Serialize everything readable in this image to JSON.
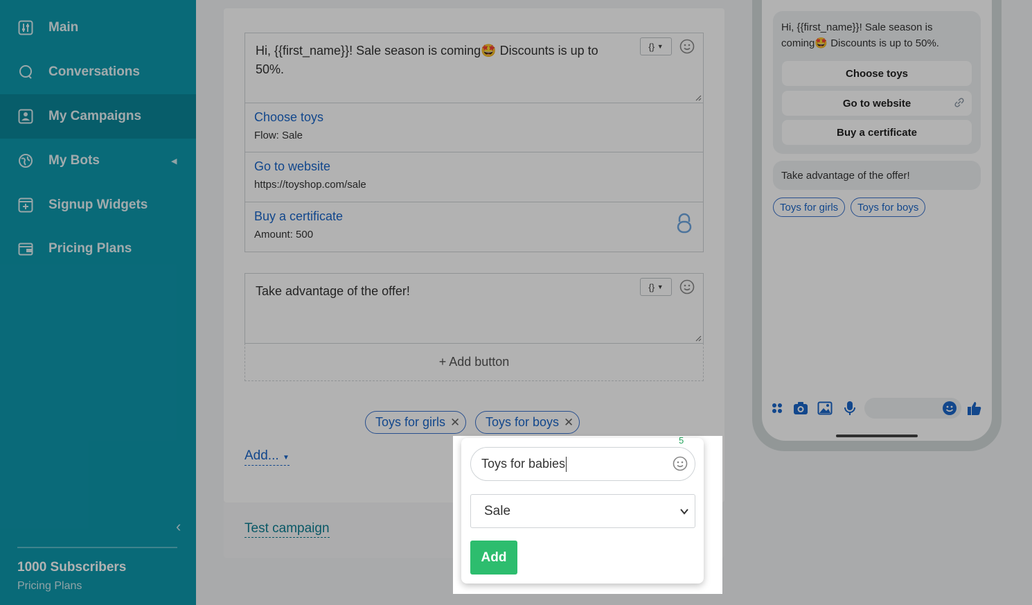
{
  "sidebar": {
    "items": [
      {
        "label": "Main",
        "icon": "sliders-icon"
      },
      {
        "label": "Conversations",
        "icon": "chat-bubble-icon"
      },
      {
        "label": "My Campaigns",
        "icon": "campaign-icon"
      },
      {
        "label": "My Bots",
        "icon": "globe-icon"
      },
      {
        "label": "Signup Widgets",
        "icon": "widget-plus-icon"
      },
      {
        "label": "Pricing Plans",
        "icon": "wallet-icon"
      }
    ],
    "active_item": "My Campaigns",
    "subscribers": "1000 Subscribers",
    "pricing_link": "Pricing Plans"
  },
  "editor": {
    "message1": {
      "text": "Hi,  {{first_name}}! Sale season is coming🤩 Discounts is up to 50%.",
      "var_button": "{}"
    },
    "buttons": [
      {
        "title": "Choose toys",
        "subtitle": "Flow: Sale"
      },
      {
        "title": "Go to website",
        "subtitle": "https://toyshop.com/sale"
      },
      {
        "title": "Buy a certificate",
        "subtitle": "Amount: 500"
      }
    ],
    "message2": {
      "text": "Take advantage of the offer!",
      "var_button": "{}"
    },
    "add_button_label": "+ Add button",
    "quick_replies": [
      "Toys for girls",
      "Toys for boys"
    ],
    "add_dropdown_label": "Add...",
    "test_campaign_label": "Test campaign"
  },
  "preview": {
    "message1": "Hi,  {{first_name}}! Sale season is coming🤩 Discounts is up to 50%.",
    "buttons": [
      "Choose toys",
      "Go to website",
      "Buy a certificate"
    ],
    "message2": "Take advantage of the offer!",
    "quick_replies": [
      "Toys for girls",
      "Toys for boys"
    ]
  },
  "popover": {
    "char_count": "5",
    "input_value": "Toys for babies",
    "select_value": "Sale",
    "add_label": "Add"
  },
  "colors": {
    "sidebar": "#0e98ad",
    "link": "#1a66c9",
    "add_button": "#2dbd6e"
  }
}
